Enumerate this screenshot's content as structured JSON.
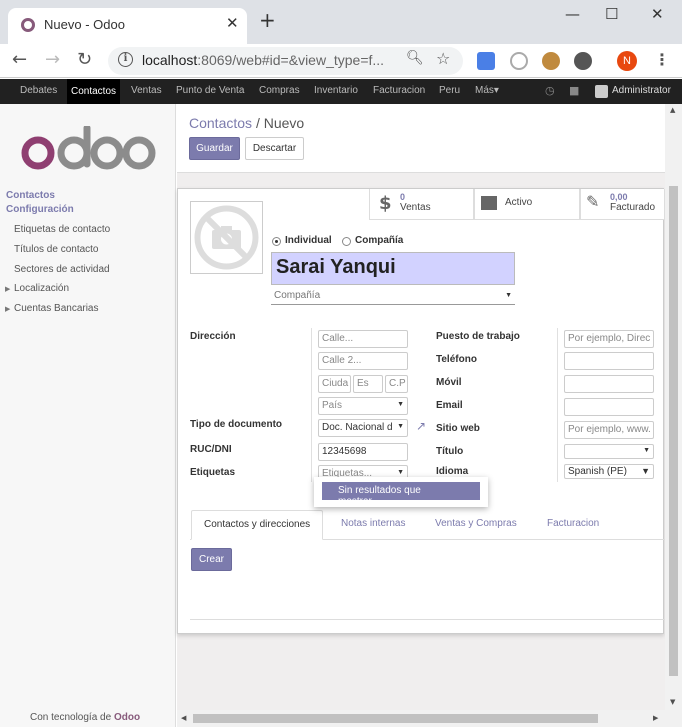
{
  "browser": {
    "tab_title": "Nuevo - Odoo",
    "tab_close": "✕",
    "new_tab": "+",
    "url_host": "localhost",
    "url_rest": ":8069/web#id=&view_type=f...",
    "profile_initial": "N",
    "win_minimize": "—",
    "win_maximize": "☐",
    "win_close": "✕"
  },
  "odoo_nav": {
    "items": [
      "Debates",
      "Contactos",
      "Ventas",
      "Punto de Venta",
      "Compras",
      "Inventario",
      "Facturacion",
      "Peru",
      "Más"
    ],
    "active": "Contactos",
    "user": "Administrator"
  },
  "sidebar": {
    "logo_text": "odoo",
    "sections": [
      "Contactos",
      "Configuración"
    ],
    "items": [
      "Etiquetas de contacto",
      "Títulos de contacto",
      "Sectores de actividad",
      "Localización",
      "Cuentas Bancarias"
    ],
    "footer_prefix": "Con tecnología de",
    "footer_brand": "Odoo"
  },
  "breadcrumb": {
    "parent": "Contactos",
    "separator": "/",
    "current": "Nuevo"
  },
  "buttons": {
    "save": "Guardar",
    "discard": "Descartar",
    "create": "Crear"
  },
  "stats": [
    {
      "value": "0",
      "label": "Ventas"
    },
    {
      "value": "",
      "label": "Activo"
    },
    {
      "value": "0,00",
      "label": "Facturado"
    }
  ],
  "partner_type": {
    "individual": "Individual",
    "company": "Compañía",
    "selected": "Individual"
  },
  "partner_name": "Sarai Yanqui",
  "company_placeholder": "Compañía",
  "left_fields": {
    "address_label": "Dirección",
    "street": "Calle...",
    "street2": "Calle 2...",
    "city": "Ciuda",
    "state": "Es",
    "zip": "C.P",
    "country": "País",
    "doc_type_label": "Tipo de documento",
    "doc_type_value": "Doc. Nacional d",
    "vat_label": "RUC/DNI",
    "vat_value": "12345698",
    "tags_label": "Etiquetas",
    "tags_placeholder": "Etiquetas..."
  },
  "right_fields": {
    "job_label": "Puesto de trabajo",
    "job_placeholder": "Por ejemplo, Direc",
    "phone_label": "Teléfono",
    "mobile_label": "Móvil",
    "email_label": "Email",
    "website_label": "Sitio web",
    "website_placeholder": "Por ejemplo, www.",
    "title_label": "Título",
    "lang_label": "Idioma",
    "lang_value": "Spanish (PE)"
  },
  "tags_dropdown": {
    "no_results": "Sin resultados que mostrar..."
  },
  "tabs": [
    "Contactos y direcciones",
    "Notas internas",
    "Ventas y Compras",
    "Facturacion"
  ],
  "colors": {
    "accent": "#7C7BAD",
    "brand": "#875A7B",
    "navbar": "#212121",
    "name_bg": "#d2d2ff"
  }
}
